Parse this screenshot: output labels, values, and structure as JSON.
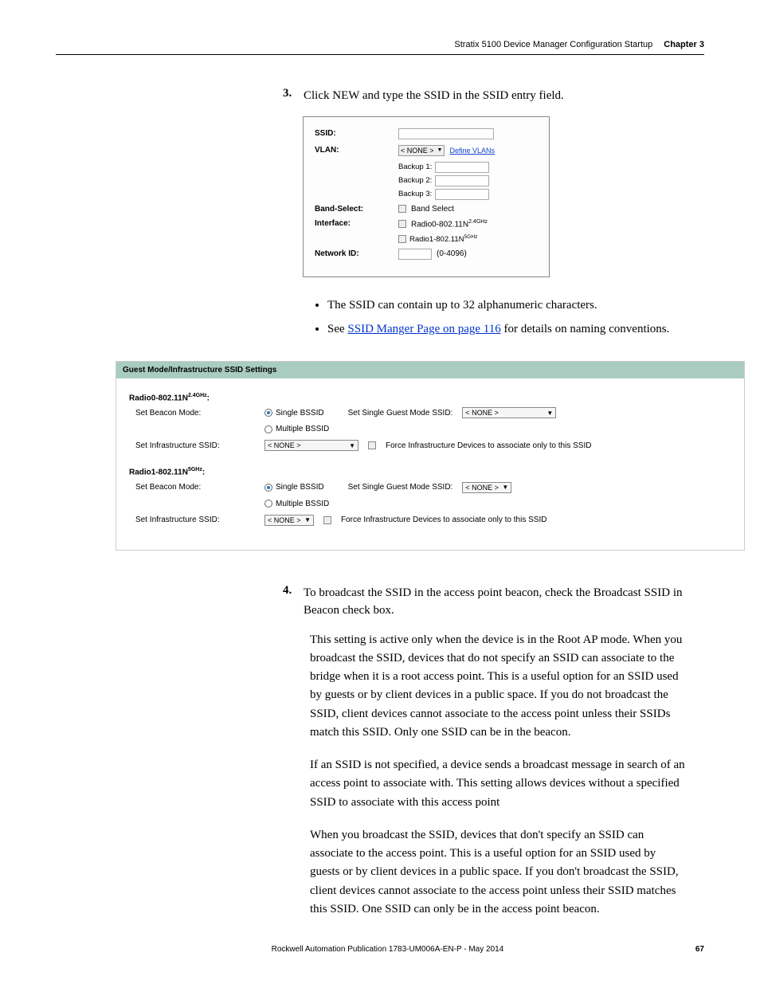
{
  "header": {
    "title": "Stratix 5100 Device Manager Configuration Startup",
    "chapter": "Chapter 3"
  },
  "step3": {
    "num": "3.",
    "text": "Click NEW and type the SSID in the SSID entry field."
  },
  "figure1": {
    "ssid_label": "SSID:",
    "vlan_label": "VLAN:",
    "vlan_select": "< NONE >",
    "define_vlans": "Define VLANs",
    "backup1": "Backup 1:",
    "backup2": "Backup 2:",
    "backup3": "Backup 3:",
    "band_select_label": "Band-Select:",
    "band_select_opt": "Band Select",
    "interface_label": "Interface:",
    "iface0": "Radio0-802.11N",
    "iface0_sup": "2.4GHz",
    "iface1": "Radio1-802.11N",
    "iface1_sup": "5GHz",
    "network_id_label": "Network ID:",
    "network_id_range": "(0-4096)"
  },
  "bullets": {
    "b1": "The SSID can contain up to 32 alphanumeric characters.",
    "b2_prefix": "See ",
    "b2_link": "SSID Manger Page on page 116",
    "b2_suffix": " for details on naming conventions."
  },
  "figure2": {
    "title": "Guest Mode/Infrastructure SSID Settings",
    "r0_label": "Radio0-802.11N",
    "r0_sup": "2.4GHz",
    "r0_colon": ":",
    "beacon_label": "Set Beacon Mode:",
    "single_bssid": "Single BSSID",
    "multiple_bssid": "Multiple BSSID",
    "set_single_guest": "Set Single Guest Mode SSID:",
    "none_opt": "< NONE >",
    "infra_label": "Set Infrastructure SSID:",
    "force_infra": "Force Infrastructure Devices to associate only to this SSID",
    "r1_label": "Radio1-802.11N",
    "r1_sup": "5GHz",
    "r1_colon": ":"
  },
  "step4": {
    "num": "4.",
    "text": "To broadcast the SSID in the access point beacon, check the Broadcast SSID in Beacon check box."
  },
  "para1": "This setting is active only when the device is in the Root AP mode. When you broadcast the SSID, devices that do not specify an SSID can associate to the bridge when it is a root access point. This is a useful option for an SSID used by guests or by client devices in a public space. If you do not broadcast the SSID, client devices cannot associate to the access point unless their SSIDs match this SSID. Only one SSID can be in the beacon.",
  "para2": "If an SSID is not specified, a device sends a broadcast message in search of an access point to associate with. This setting allows devices without a specified SSID to associate with this access point",
  "para3": "When you broadcast the SSID, devices that don't specify an SSID can associate to the access point. This is a useful option for an SSID used by guests or by client devices in a public space. If you don't broadcast the SSID, client devices cannot associate to the access point unless their SSID matches this SSID. One SSID can only be in the access point beacon.",
  "footer": {
    "publication": "Rockwell Automation Publication 1783-UM006A-EN-P - May 2014",
    "page": "67"
  }
}
